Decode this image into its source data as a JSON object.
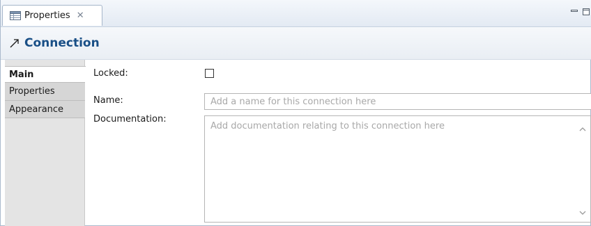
{
  "view_tab": {
    "label": "Properties",
    "icon": "properties-table-icon",
    "close_icon": "close-icon"
  },
  "window_controls": {
    "minimize_icon": "minimize-icon",
    "maximize_icon": "maximize-icon"
  },
  "header": {
    "icon": "connection-arrow-icon",
    "title": "Connection"
  },
  "sidebar": {
    "items": [
      {
        "label": "Main",
        "active": true
      },
      {
        "label": "Properties",
        "active": false
      },
      {
        "label": "Appearance",
        "active": false
      }
    ]
  },
  "form": {
    "locked_label": "Locked:",
    "locked_checked": false,
    "name_label": "Name:",
    "name_value": "",
    "name_placeholder": "Add a name for this connection here",
    "documentation_label": "Documentation:",
    "documentation_value": "",
    "documentation_placeholder": "Add documentation relating to this connection here"
  },
  "colors": {
    "title_text": "#194f86",
    "tab_bar_bg": "#e3eaf3",
    "sidebar_bg": "#e4e4e4",
    "placeholder_text": "#a8a8a8"
  }
}
